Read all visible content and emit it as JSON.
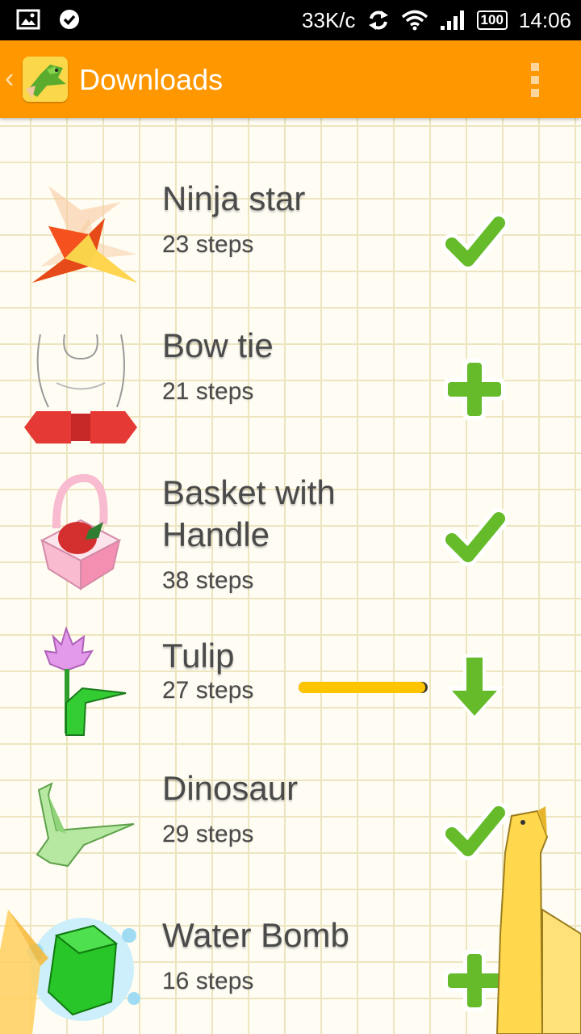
{
  "status_bar": {
    "speed": "33K/c",
    "battery": "100",
    "time": "14:06"
  },
  "app_bar": {
    "title": "Downloads"
  },
  "items": [
    {
      "title": "Ninja star",
      "steps": "23 steps",
      "action": "downloaded-check"
    },
    {
      "title": "Bow tie",
      "steps": "21 steps",
      "action": "add"
    },
    {
      "title": "Basket with Handle",
      "steps": "38 steps",
      "action": "downloaded-check"
    },
    {
      "title": "Tulip",
      "steps": "27 steps",
      "action": "downloading",
      "progress": 0.98
    },
    {
      "title": "Dinosaur",
      "steps": "29 steps",
      "action": "downloaded-check"
    },
    {
      "title": "Water Bomb",
      "steps": "16 steps",
      "action": "add"
    }
  ],
  "colors": {
    "app_bar": "#ff9800",
    "action_green": "#66bb2a",
    "progress": "#ffc400",
    "grid_line": "#ece5bf",
    "background": "#fffdf3"
  }
}
